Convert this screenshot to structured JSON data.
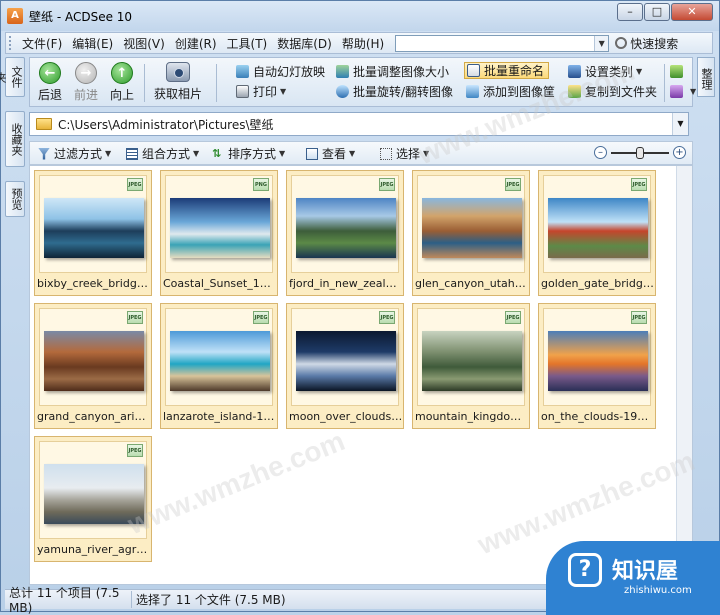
{
  "window": {
    "title": "壁纸 - ACDSee 10",
    "app_icon": "acdsee-icon",
    "controls": [
      "minimize",
      "maximize",
      "close"
    ]
  },
  "menubar": {
    "items": [
      "文件(F)",
      "编辑(E)",
      "视图(V)",
      "创建(R)",
      "工具(T)",
      "数据库(D)",
      "帮助(H)"
    ],
    "search_value": "",
    "quick_search_label": "快速搜索"
  },
  "sidetabs": [
    "文件夹",
    "收藏夹",
    "预览"
  ],
  "righttab": "整理",
  "toolbar": {
    "back_label": "后退",
    "forward_label": "前进",
    "up_label": "向上",
    "acquire_label": "获取相片",
    "buttons": {
      "slideshow": "自动幻灯放映",
      "print": "打印",
      "batch_resize": "批量调整图像大小",
      "batch_rotate": "批量旋转/翻转图像",
      "batch_rename": "批量重命名",
      "add_to_basket": "添加到图像筐",
      "set_category": "设置类别",
      "copy_to_folder": "复制到文件夹"
    }
  },
  "address": {
    "path": "C:\\Users\\Administrator\\Pictures\\壁纸"
  },
  "filterbar": {
    "filter": "过滤方式",
    "group": "组合方式",
    "sort": "排序方式",
    "view": "查看",
    "select": "选择",
    "zoom_level": 0.5
  },
  "files": [
    {
      "name": "bixby_creek_bridge_...",
      "badge": "JPEG"
    },
    {
      "name": "Coastal_Sunset_1920...",
      "badge": "PNG"
    },
    {
      "name": "fjord_in_new_zealan...",
      "badge": "JPEG"
    },
    {
      "name": "glen_canyon_utah-1...",
      "badge": "JPEG"
    },
    {
      "name": "golden_gate_bridge_...",
      "badge": "JPEG"
    },
    {
      "name": "grand_canyon_arizo...",
      "badge": "JPEG"
    },
    {
      "name": "lanzarote_island-192...",
      "badge": "JPEG"
    },
    {
      "name": "moon_over_clouds-...",
      "badge": "JPEG"
    },
    {
      "name": "mountain_kingdom-...",
      "badge": "JPEG"
    },
    {
      "name": "on_the_clouds-1920x...",
      "badge": "JPEG"
    },
    {
      "name": "yamuna_river_agra_i...",
      "badge": "JPEG"
    }
  ],
  "statusbar": {
    "total": "总计 11 个项目 (7.5 MB)",
    "selected": "选择了 11 个文件 (7.5 MB)"
  },
  "watermark": {
    "site": "www.wmzhe.com"
  },
  "logo": {
    "title": "知识屋",
    "subtitle": "zhishiwu.com"
  },
  "colors": {
    "selection": "#fcedc4",
    "frame_blue": "#5b7ea8",
    "logo_blue": "#2f82d2"
  }
}
